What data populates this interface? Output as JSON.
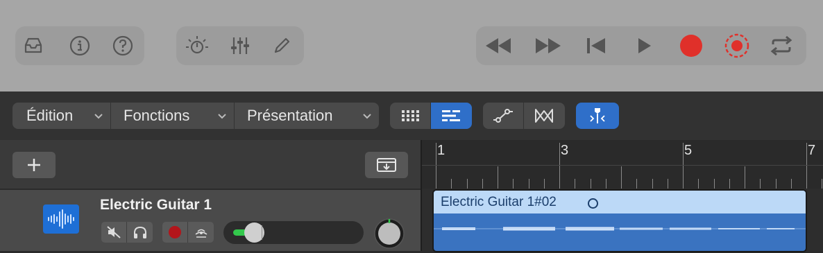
{
  "topbar": {
    "left_icons": [
      "inbox-icon",
      "info-icon",
      "help-icon"
    ],
    "center_icons": [
      "brightness-icon",
      "mixer-icon",
      "pencil-icon"
    ],
    "transport_icons": [
      "rewind-icon",
      "fast-forward-icon",
      "go-to-start-icon",
      "play-icon",
      "record-icon",
      "capture-record-icon",
      "cycle-icon"
    ],
    "record_color": "#e0302a"
  },
  "toolbar": {
    "menus": [
      {
        "label": "Édition"
      },
      {
        "label": "Fonctions"
      },
      {
        "label": "Présentation"
      }
    ],
    "view_toggle": {
      "icons": [
        "grid-view-icon",
        "list-view-icon"
      ],
      "selected": "list-view-icon"
    },
    "automation": {
      "icons": [
        "automation-icon",
        "flex-icon"
      ]
    },
    "snap": {
      "icon": "catch-playhead-icon",
      "active": true
    },
    "accent": "#2f6fc9"
  },
  "tracks_header": {
    "add_icon": "plus-icon",
    "global_icon": "global-tracks-icon"
  },
  "ruler": {
    "bars": [
      "1",
      "3",
      "5",
      "7"
    ]
  },
  "track": {
    "name": "Electric Guitar 1",
    "icon": "audio-waveform-icon",
    "controls": [
      "mute-icon",
      "headphones-icon",
      "record-arm-icon",
      "input-monitor-icon"
    ],
    "volume_fraction": 0.15,
    "track_color": "#1e6fd6"
  },
  "region": {
    "name": "Electric Guitar 1#02",
    "color": "#3a73c0",
    "header_color": "#bcd9f7"
  }
}
